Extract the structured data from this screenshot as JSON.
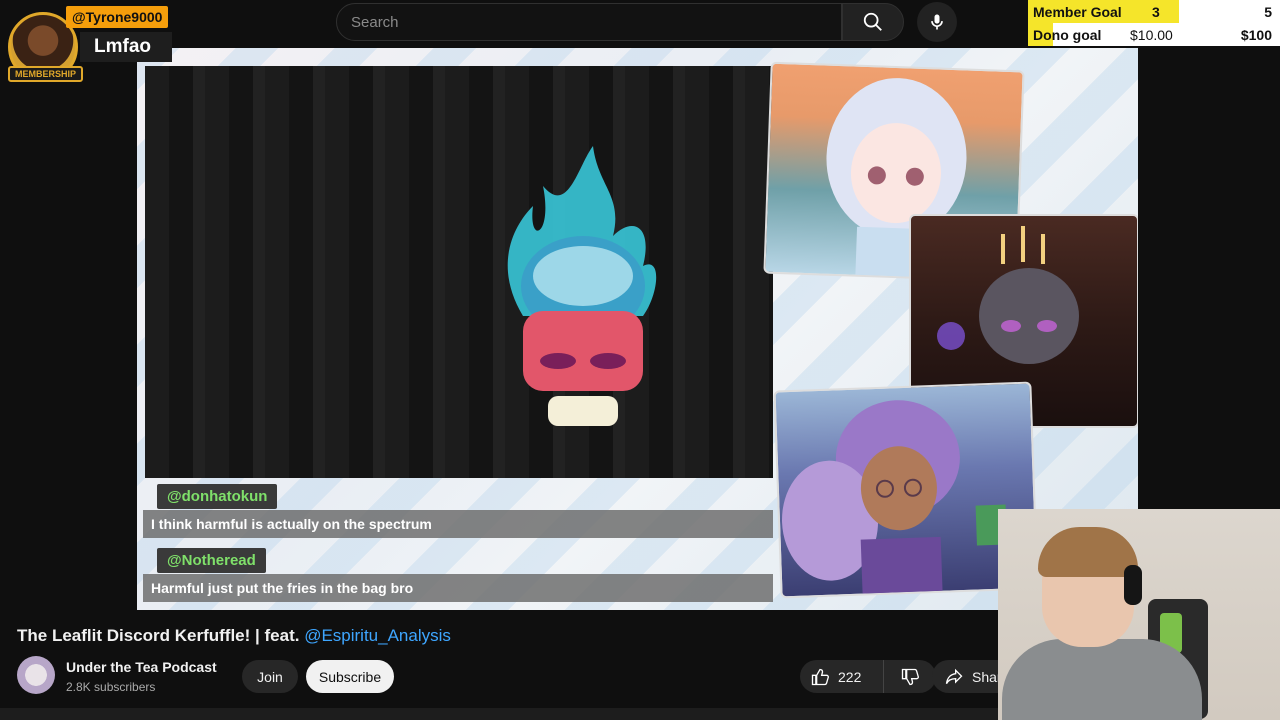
{
  "search": {
    "placeholder": "Search"
  },
  "icons": {
    "search": "search-icon",
    "mic": "mic-icon",
    "like": "thumbs-up-icon",
    "dislike": "thumbs-down-icon",
    "share": "share-icon"
  },
  "member_alert": {
    "username": "@Tyrone9000",
    "message": "Lmfao",
    "badge": "MEMBERSHIP"
  },
  "goals": {
    "member": {
      "label": "Member Goal",
      "current": "3",
      "target": "5",
      "progress": 0.6
    },
    "dono": {
      "label": "Dono goal",
      "current": "$10.00",
      "target": "$100",
      "progress": 0.1
    }
  },
  "chat_overlay": [
    {
      "username": "@donhatokun",
      "message": "I think harmful is actually on the spectrum"
    },
    {
      "username": "@Notheread",
      "message": "Harmful just put the fries in the bag bro"
    }
  ],
  "video": {
    "title": "The Leaflit Discord Kerfuffle! | feat. ",
    "title_mention": "@Espiritu_Analysis",
    "channel_name": "Under the Tea Podcast",
    "subscribers": "2.8K subscribers",
    "join_label": "Join",
    "subscribe_label": "Subscribe",
    "likes": "222",
    "share_label": "Shar"
  },
  "colors": {
    "accent_link": "#3ea6ff",
    "chat_username": "#7fe06a",
    "goal_fill": "#f5e52a",
    "member_highlight": "#f59e0b"
  }
}
